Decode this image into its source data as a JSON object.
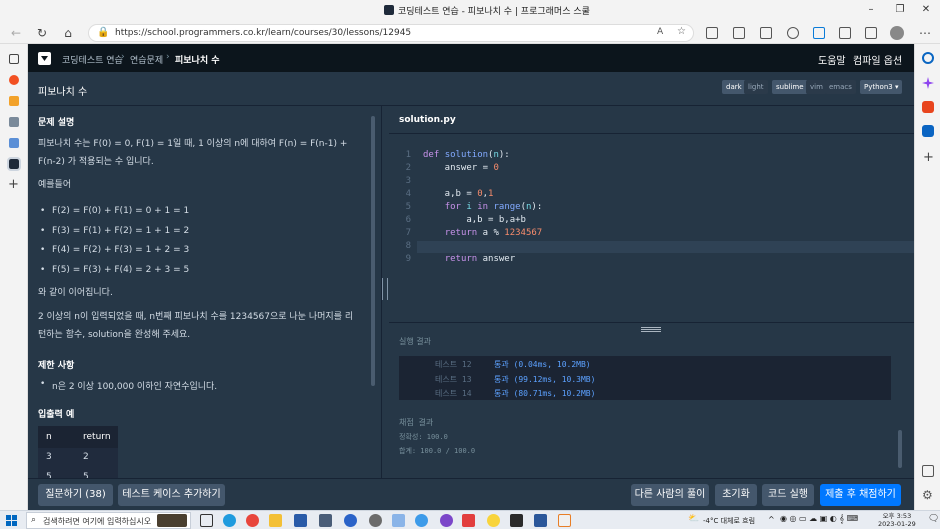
{
  "browser": {
    "tab_title": "코딩테스트 연습 - 피보나치 수 | 프로그래머스 스쿨",
    "url": "https://school.programmers.co.kr/learn/courses/30/lessons/12945"
  },
  "header": {
    "breadcrumbs": [
      "코딩테스트 연습",
      "연습문제",
      "피보나치 수"
    ],
    "help": "도움말",
    "compile_options": "컴파일 옵션"
  },
  "problem_bar": {
    "title": "피보나치 수",
    "theme": [
      "dark",
      "light"
    ],
    "keymap": [
      "sublime",
      "vim",
      "emacs"
    ],
    "language": "Python3"
  },
  "description": {
    "heading": "문제 설명",
    "intro": "피보나치 수는 F(0) = 0, F(1) = 1일 때, 1 이상의 n에 대하여 F(n) = F(n-1) + F(n-2) 가 적용되는 수 입니다.",
    "example_intro": "예를들어",
    "examples": [
      "F(2) = F(0) + F(1) = 0 + 1 = 1",
      "F(3) = F(1) + F(2) = 1 + 1 = 2",
      "F(4) = F(2) + F(3) = 1 + 2 = 3",
      "F(5) = F(3) + F(4) = 2 + 3 = 5"
    ],
    "continues": "와 같이 이어집니다.",
    "task": "2 이상의 n이 입력되었을 때, n번째 피보나치 수를 1234567으로 나눈 나머지를 리턴하는 함수, solution을 완성해 주세요.",
    "constraints_heading": "제한 사항",
    "constraints": [
      "n은 2 이상 100,000 이하인 자연수입니다."
    ],
    "io_heading": "입출력 예",
    "io_columns": [
      "n",
      "return"
    ],
    "io_rows": [
      [
        "3",
        "2"
      ],
      [
        "5",
        "5"
      ]
    ]
  },
  "editor": {
    "filename": "solution.py",
    "line_numbers": [
      "1",
      "2",
      "3",
      "4",
      "5",
      "6",
      "7",
      "8",
      "9"
    ]
  },
  "results": {
    "label": "실행 결과",
    "tests": [
      {
        "name": "테스트 12",
        "result": "통과 (0.04ms, 10.2MB)"
      },
      {
        "name": "테스트 13",
        "result": "통과 (99.12ms, 10.3MB)"
      },
      {
        "name": "테스트 14",
        "result": "통과 (80.71ms, 10.2MB)"
      }
    ],
    "grade_heading": "채점 결과",
    "accuracy": "정확성: 100.0",
    "total": "합계: 100.0 / 100.0"
  },
  "actions": {
    "questions": "질문하기 (38)",
    "add_testcase": "테스트 케이스 추가하기",
    "others_solutions": "다른 사람의 풀이",
    "reset": "초기화",
    "run": "코드 실행",
    "submit": "제출 후 채점하기"
  },
  "taskbar": {
    "search_placeholder": "검색하려면 여기에 입력하십시오",
    "weather": "-4°C 대체로 흐림",
    "time": "오후 3:53",
    "date": "2023-01-29"
  }
}
